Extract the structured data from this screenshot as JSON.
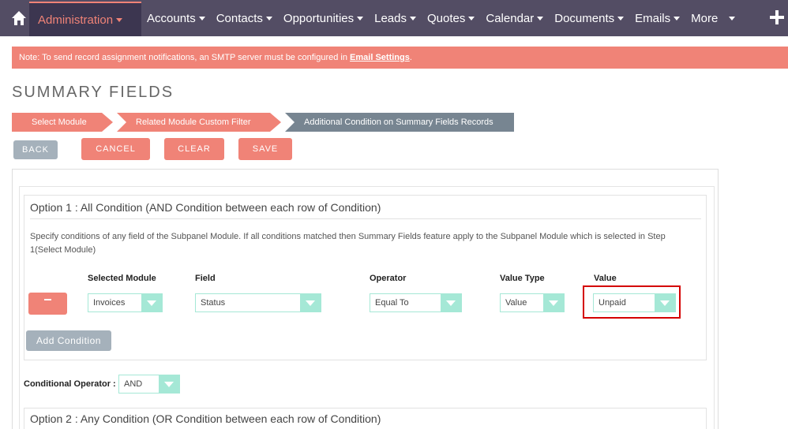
{
  "nav": {
    "active_tab": "Administration",
    "items": [
      "Accounts",
      "Contacts",
      "Opportunities",
      "Leads",
      "Quotes",
      "Calendar",
      "Documents",
      "Emails",
      "More"
    ]
  },
  "notice": {
    "text": "Note: To send record assignment notifications, an SMTP server must be configured in ",
    "link": "Email Settings",
    "suffix": "."
  },
  "page_title": "SUMMARY FIELDS",
  "steps": [
    "Select Module",
    "Related Module Custom Filter",
    "Additional Condition on Summary Fields Records"
  ],
  "buttons": {
    "back": "BACK",
    "cancel": "CANCEL",
    "clear": "CLEAR",
    "save": "SAVE"
  },
  "option1": {
    "title": "Option 1 : All Condition (AND Condition between each row of Condition)",
    "description": "Specify conditions of any field of the Subpanel Module. If all conditions matched then Summary Fields feature apply to the Subpanel Module which is selected in Step 1(Select Module)",
    "columns": {
      "module": "Selected Module",
      "field": "Field",
      "operator": "Operator",
      "value_type": "Value Type",
      "value": "Value"
    },
    "row": {
      "module": "Invoices",
      "field": "Status",
      "operator": "Equal To",
      "value_type": "Value",
      "value": "Unpaid"
    },
    "add_condition": "Add Condition"
  },
  "conditional_operator": {
    "label": "Conditional Operator :",
    "value": "AND"
  },
  "option2": {
    "title": "Option 2 : Any Condition (OR Condition between each row of Condition)"
  },
  "colors": {
    "nav_bg": "#534d64",
    "accent": "#f08377",
    "select_border": "#a5e8d6",
    "highlight": "#d40000",
    "grey_button": "#a5b1bb"
  }
}
